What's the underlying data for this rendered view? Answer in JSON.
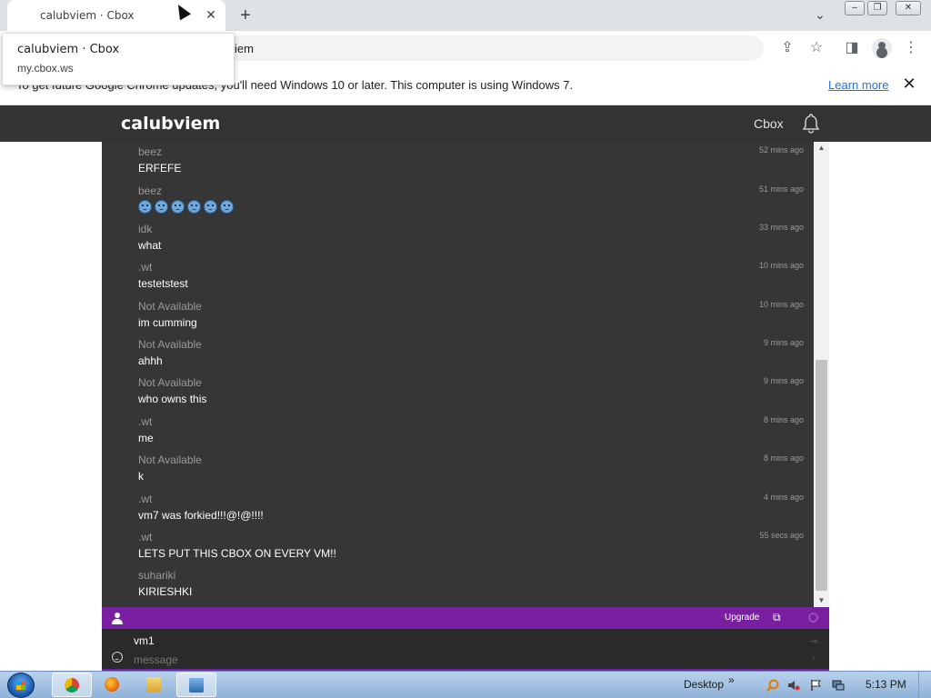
{
  "browser": {
    "tab_title": "calubviem · Cbox",
    "address_partial": "iem",
    "hovercard": {
      "title": "calubviem · Cbox",
      "url": "my.cbox.ws"
    },
    "infobar": {
      "message": "To get future Google Chrome updates, you'll need Windows 10 or later. This computer is using Windows 7.",
      "link": "Learn more"
    }
  },
  "site": {
    "title": "calubviem",
    "nav_link": "Cbox"
  },
  "messages": [
    {
      "name": "beez",
      "time": "52 mins ago",
      "text": "ERFEFE"
    },
    {
      "name": "beez",
      "time": "51 mins ago",
      "text": "",
      "emoji_count": 6
    },
    {
      "name": "idk",
      "time": "33 mins ago",
      "text": "what"
    },
    {
      "name": ".wt",
      "time": "10 mins ago",
      "text": "testetstest"
    },
    {
      "name": "Not Available",
      "time": "10 mins ago",
      "text": "im cumming"
    },
    {
      "name": "Not Available",
      "time": "9 mins ago",
      "text": "ahhh"
    },
    {
      "name": "Not Available",
      "time": "9 mins ago",
      "text": "who owns this"
    },
    {
      "name": ".wt",
      "time": "8 mins ago",
      "text": "me"
    },
    {
      "name": "Not Available",
      "time": "8 mins ago",
      "text": "k"
    },
    {
      "name": ".wt",
      "time": "4 mins ago",
      "text": "vm7 was forkied!!!@!@!!!!"
    },
    {
      "name": ".wt",
      "time": "55 secs ago",
      "text": "LETS PUT THIS CBOX ON EVERY VM!!"
    },
    {
      "name": "suhariki",
      "time": "",
      "text": "KIRIESHKI"
    }
  ],
  "chatbar": {
    "upgrade_label": "Upgrade"
  },
  "input": {
    "name_value": "vm1",
    "message_placeholder": "message"
  },
  "taskbar": {
    "desktop_label": "Desktop",
    "clock": "5:13 PM"
  },
  "colors": {
    "accent": "#7b1fa2",
    "chat_bg": "#363636",
    "header_bg": "#333333"
  }
}
